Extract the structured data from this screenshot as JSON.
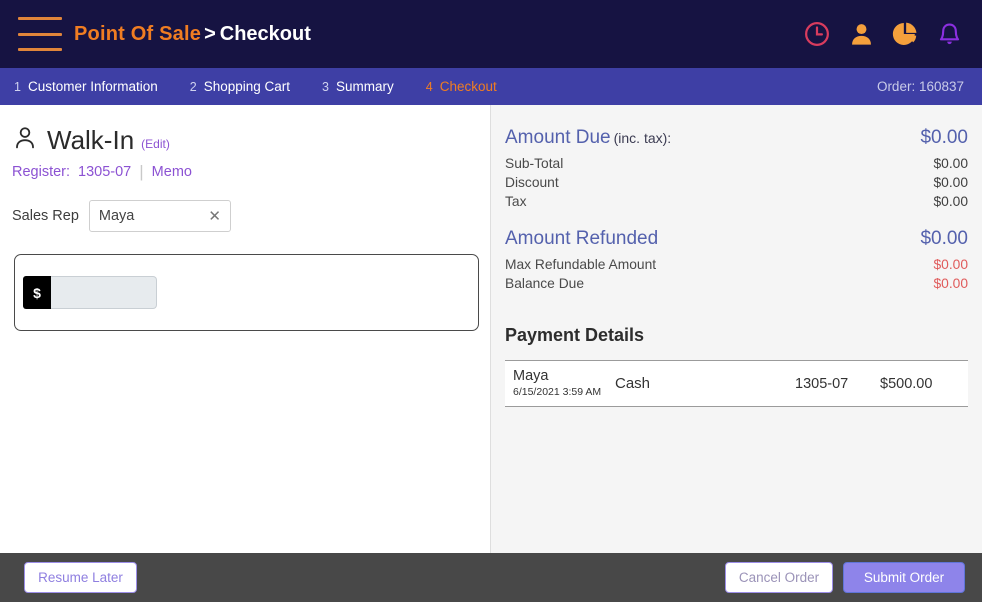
{
  "header": {
    "menu_icon": "hamburger-menu-icon",
    "brand": "Point Of Sale",
    "separator": ">",
    "page": "Checkout",
    "icons": [
      {
        "name": "clock-icon",
        "color": "#d93c5e"
      },
      {
        "name": "user-icon",
        "color": "#f5a03c"
      },
      {
        "name": "pie-chart-icon",
        "color": "#f5a03c"
      },
      {
        "name": "bell-icon",
        "color": "#8b2fe0"
      }
    ],
    "colors": {
      "background": "#161342",
      "brand": "#f07d22",
      "page": "#ffffff"
    }
  },
  "steps": {
    "items": [
      {
        "num": "1",
        "label": "Customer Information",
        "active": false
      },
      {
        "num": "2",
        "label": "Shopping Cart",
        "active": false
      },
      {
        "num": "3",
        "label": "Summary",
        "active": false
      },
      {
        "num": "4",
        "label": "Checkout",
        "active": true
      }
    ],
    "order_label": "Order: 160837",
    "colors": {
      "background": "#3e3fa5",
      "active": "#f07d22"
    }
  },
  "customer": {
    "avatar_icon": "person-outline-icon",
    "name": "Walk-In",
    "edit_label": "(Edit)",
    "register_label": "Register:",
    "register_value": "1305-07",
    "memo_label": "Memo"
  },
  "sales_rep": {
    "label": "Sales Rep",
    "value": "Maya",
    "placeholder": "Sales Rep",
    "clear_icon": "✕"
  },
  "payment_entry": {
    "currency_prefix": "$",
    "amount_value": "",
    "amount_placeholder": ""
  },
  "totals": {
    "amount_due_label": "Amount Due",
    "amount_due_note": "(inc. tax):",
    "amount_due_value": "$0.00",
    "rows": [
      {
        "label": "Sub-Total",
        "value": "$0.00"
      },
      {
        "label": "Discount",
        "value": "$0.00"
      },
      {
        "label": "Tax",
        "value": "$0.00"
      }
    ],
    "amount_refunded_label": "Amount Refunded",
    "amount_refunded_value": "$0.00",
    "refund_rows": [
      {
        "label": "Max Refundable Amount",
        "value": "$0.00"
      },
      {
        "label": "Balance Due",
        "value": "$0.00"
      }
    ],
    "colors": {
      "heading": "#5461ad",
      "negative": "#e05b5b"
    }
  },
  "payment_details": {
    "title": "Payment Details",
    "rows": [
      {
        "who": "Maya",
        "date": "6/15/2021 3:59 AM",
        "method": "Cash",
        "register": "1305-07",
        "amount": "$500.00"
      }
    ]
  },
  "footer": {
    "resume_later": "Resume Later",
    "cancel_order": "Cancel Order",
    "submit_order": "Submit Order",
    "colors": {
      "background": "#484848",
      "submit": "#8e84ea",
      "link": "#8f7fe0"
    }
  }
}
